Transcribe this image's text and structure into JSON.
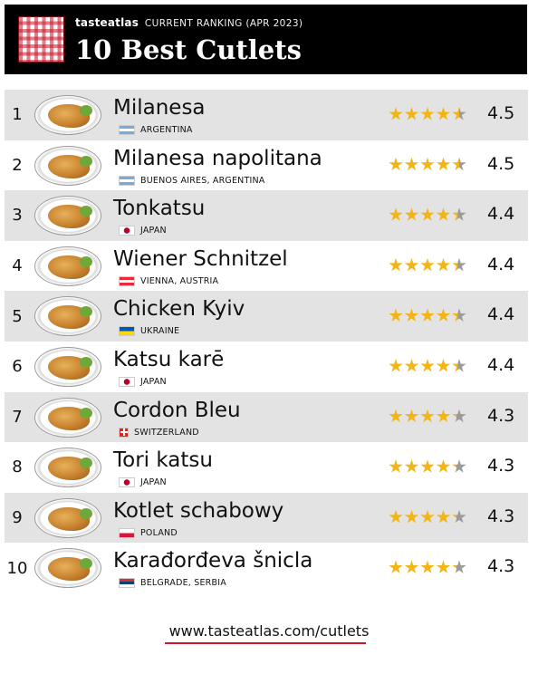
{
  "header": {
    "brand": "tasteatlas",
    "subtitle": "CURRENT RANKING (APR 2023)",
    "title": "10 Best Cutlets"
  },
  "items": [
    {
      "rank": "1",
      "name": "Milanesa",
      "origin": "ARGENTINA",
      "flag": "argentina",
      "rating": "4.5",
      "rating_value": 4.5
    },
    {
      "rank": "2",
      "name": "Milanesa napolitana",
      "origin": "BUENOS AIRES, ARGENTINA",
      "flag": "argentina",
      "rating": "4.5",
      "rating_value": 4.5
    },
    {
      "rank": "3",
      "name": "Tonkatsu",
      "origin": "JAPAN",
      "flag": "japan",
      "rating": "4.4",
      "rating_value": 4.4
    },
    {
      "rank": "4",
      "name": "Wiener Schnitzel",
      "origin": "VIENNA, AUSTRIA",
      "flag": "austria",
      "rating": "4.4",
      "rating_value": 4.4
    },
    {
      "rank": "5",
      "name": "Chicken Kyiv",
      "origin": "UKRAINE",
      "flag": "ukraine",
      "rating": "4.4",
      "rating_value": 4.4
    },
    {
      "rank": "6",
      "name": "Katsu karē",
      "origin": "JAPAN",
      "flag": "japan",
      "rating": "4.4",
      "rating_value": 4.4
    },
    {
      "rank": "7",
      "name": "Cordon Bleu",
      "origin": "SWITZERLAND",
      "flag": "switzerland",
      "rating": "4.3",
      "rating_value": 4.3
    },
    {
      "rank": "8",
      "name": "Tori katsu",
      "origin": "JAPAN",
      "flag": "japan",
      "rating": "4.3",
      "rating_value": 4.3
    },
    {
      "rank": "9",
      "name": "Kotlet schabowy",
      "origin": "POLAND",
      "flag": "poland",
      "rating": "4.3",
      "rating_value": 4.3
    },
    {
      "rank": "10",
      "name": "Karađorđeva šnicla",
      "origin": "BELGRADE, SERBIA",
      "flag": "serbia",
      "rating": "4.3",
      "rating_value": 4.3
    }
  ],
  "footer": {
    "url": "www.tasteatlas.com/cutlets"
  },
  "colors": {
    "header_bg": "#000000",
    "row_shade": "#e3e3e3",
    "star_filled": "#f2b515",
    "star_empty": "#9b9b9b",
    "accent": "#c8182d"
  }
}
